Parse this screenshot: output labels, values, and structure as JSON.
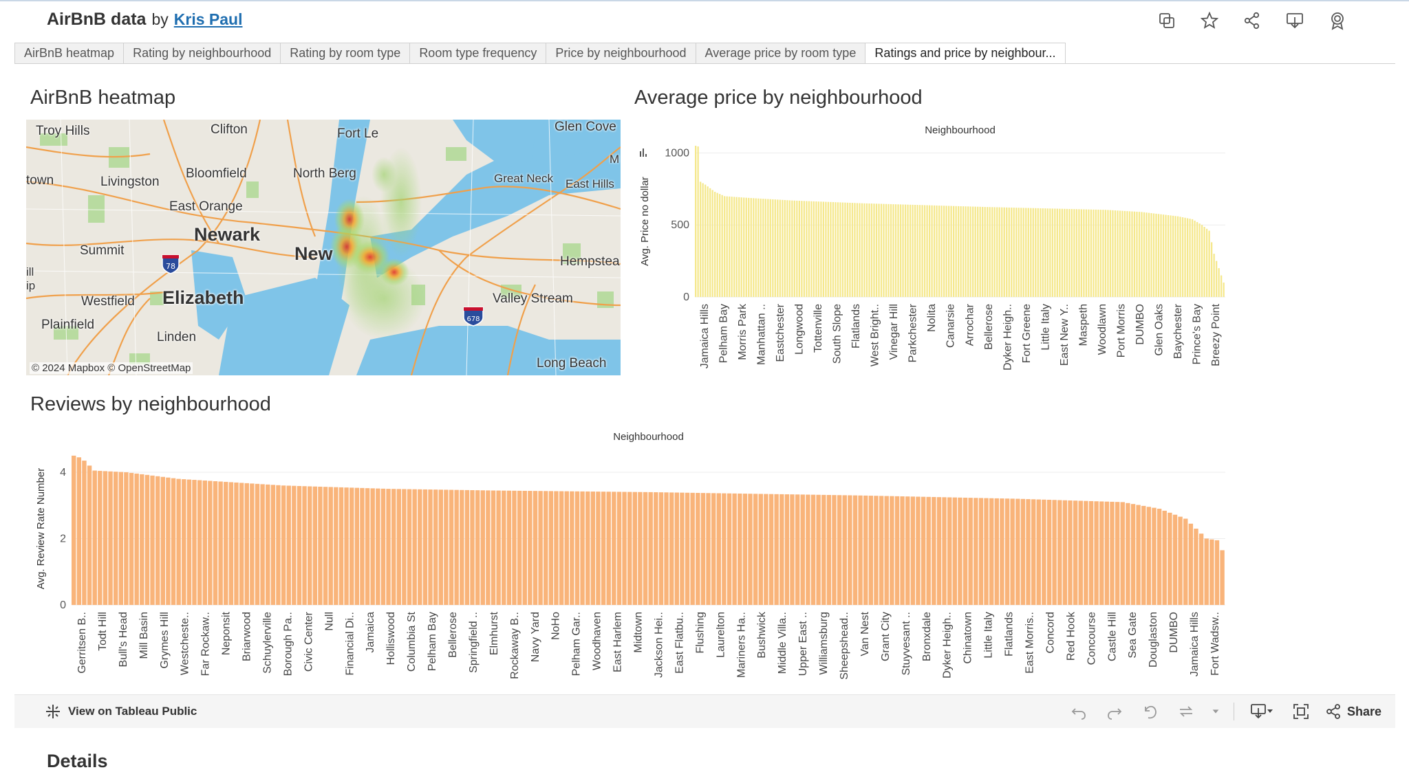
{
  "header": {
    "title": "AirBnB data",
    "by": "by",
    "author": "Kris Paul"
  },
  "header_icons": [
    "duplicate-icon",
    "star-icon",
    "share-nodes-icon",
    "download-icon",
    "badge-icon"
  ],
  "tabs": [
    {
      "label": "AirBnB heatmap"
    },
    {
      "label": "Rating by neighbourhood"
    },
    {
      "label": "Rating by room type"
    },
    {
      "label": "Room type frequency"
    },
    {
      "label": "Price by neighbourhood"
    },
    {
      "label": "Average price by room type"
    },
    {
      "label": "Ratings and price by neighbour...",
      "active": true
    }
  ],
  "map": {
    "title": "AirBnB heatmap",
    "attribution": "© 2024 Mapbox  © OpenStreetMap",
    "labels": [
      "Troy Hills",
      "Clifton",
      "Fort Le",
      "Glen Cove",
      "M",
      "Bloomfield",
      "North Berg",
      "Great Neck",
      "East Hills",
      "town",
      "Livingston",
      "East Orange",
      "Newark",
      "Summit",
      "New",
      "Hempstea",
      "ill",
      "ip",
      "Westfield",
      "Elizabeth",
      "Valley Stream",
      "Plainfield",
      "Linden",
      "Long Beach"
    ],
    "shields": [
      "78",
      "678"
    ],
    "colors": {
      "water": "#7fc4e8",
      "land": "#ebe8e0",
      "park": "#b8dba0",
      "road": "#f0a04b"
    }
  },
  "price_chart": {
    "title": "Average price by neighbourhood",
    "chart_data": {
      "type": "bar",
      "header": "Neighbourhood",
      "ylabel": "Avg. Price no dollar",
      "ylim": [
        0,
        1050
      ],
      "yticks": [
        0,
        500,
        1000
      ],
      "color": "#f5e88d",
      "bar_count": 220,
      "values_shape": [
        [
          0,
          1050
        ],
        [
          1,
          1045
        ],
        [
          2,
          800
        ],
        [
          4,
          780
        ],
        [
          8,
          730
        ],
        [
          12,
          700
        ],
        [
          20,
          690
        ],
        [
          40,
          670
        ],
        [
          70,
          650
        ],
        [
          120,
          625
        ],
        [
          170,
          605
        ],
        [
          185,
          590
        ],
        [
          200,
          560
        ],
        [
          206,
          540
        ],
        [
          210,
          500
        ],
        [
          213,
          460
        ],
        [
          215,
          300
        ],
        [
          219,
          100
        ]
      ],
      "labels": [
        "Jamaica Hills",
        "Pelham Bay",
        "Morris Park",
        "Manhattan ..",
        "Eastchester",
        "Longwood",
        "Tottenville",
        "South Slope",
        "Flatlands",
        "West Bright..",
        "Vinegar Hill",
        "Parkchester",
        "Nolita",
        "Canarsie",
        "Arrochar",
        "Bellerose",
        "Dyker Heigh..",
        "Fort Greene",
        "Little Italy",
        "East New Y..",
        "Maspeth",
        "Woodlawn",
        "Port Morris",
        "DUMBO",
        "Glen Oaks",
        "Baychester",
        "Prince's Bay",
        "Breezy Point"
      ]
    }
  },
  "reviews_chart": {
    "title": "Reviews by neighbourhood",
    "chart_data": {
      "type": "bar",
      "header": "Neighbourhood",
      "ylabel": "Avg. Review Rate Number",
      "ylim": [
        0,
        4.6
      ],
      "yticks": [
        0,
        2,
        4
      ],
      "color": "#f9b47a",
      "bar_count": 220,
      "values_shape": [
        [
          0,
          4.5
        ],
        [
          1,
          4.45
        ],
        [
          2,
          4.35
        ],
        [
          3,
          4.2
        ],
        [
          4,
          4.05
        ],
        [
          10,
          4.0
        ],
        [
          15,
          3.9
        ],
        [
          20,
          3.8
        ],
        [
          40,
          3.6
        ],
        [
          60,
          3.5
        ],
        [
          80,
          3.45
        ],
        [
          110,
          3.4
        ],
        [
          150,
          3.3
        ],
        [
          180,
          3.2
        ],
        [
          200,
          3.1
        ],
        [
          207,
          2.9
        ],
        [
          212,
          2.6
        ],
        [
          214,
          2.3
        ],
        [
          216,
          2.0
        ],
        [
          218,
          1.95
        ],
        [
          219,
          1.65
        ]
      ],
      "labels": [
        "Gerritsen B..",
        "Todt Hill",
        "Bull's Head",
        "Mill Basin",
        "Grymes Hill",
        "Westcheste..",
        "Far Rockaw..",
        "Neponsit",
        "Briarwood",
        "Schuylerville",
        "Borough Pa..",
        "Civic Center",
        "Null",
        "Financial Di..",
        "Jamaica",
        "Holliswood",
        "Columbia St",
        "Pelham Bay",
        "Bellerose",
        "Springfield ..",
        "Elmhurst",
        "Rockaway B..",
        "Navy Yard",
        "NoHo",
        "Pelham Gar..",
        "Woodhaven",
        "East Harlem",
        "Midtown",
        "Jackson Hei..",
        "East Flatbu..",
        "Flushing",
        "Laurelton",
        "Mariners Ha..",
        "Bushwick",
        "Middle Villa..",
        "Upper East ..",
        "Williamsburg",
        "Sheepshead..",
        "Van Nest",
        "Grant City",
        "Stuyvesant ..",
        "Bronxdale",
        "Dyker Heigh..",
        "Chinatown",
        "Little Italy",
        "Flatlands",
        "East Morris..",
        "Concord",
        "Red Hook",
        "Concourse",
        "Castle Hill",
        "Sea Gate",
        "Douglaston",
        "DUMBO",
        "Jamaica Hills",
        "Fort Wadsw.."
      ]
    }
  },
  "toolbar": {
    "view_label": "View on Tableau Public",
    "share_label": "Share"
  },
  "details_label": "Details"
}
